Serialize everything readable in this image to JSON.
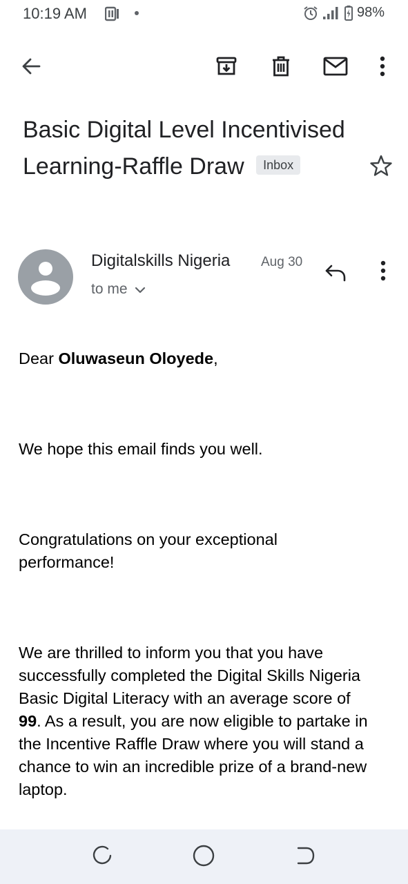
{
  "status": {
    "time": "10:19 AM",
    "battery": "98%",
    "icons": [
      "notification-icon",
      "alarm-icon",
      "signal-icon",
      "battery-icon"
    ]
  },
  "toolbar": {
    "icons": [
      "back-arrow-icon",
      "archive-icon",
      "delete-icon",
      "mark-unread-icon",
      "more-vert-icon"
    ]
  },
  "email": {
    "subject": "Basic Digital Level Incentivised Learning-Raffle Draw",
    "label": "Inbox",
    "sender": "Digitalskills  Nigeria",
    "date": "Aug 30",
    "recipient": "to me",
    "body": {
      "greeting_prefix": "Dear ",
      "recipient_name": "Oluwaseun Oloyede",
      "greeting_suffix": ",",
      "p1": "We hope this email finds you well.",
      "p2": "Congratulations on your exceptional performance!",
      "p3": "We are thrilled to inform you that you have successfully completed the Digital Skills Nigeria Basic Digital Literacy with an average score of",
      "score": "99",
      "p4": ".  As a result, you are now eligible to  partake in the Incentive Raffle Draw where you will stand a chance to win an incredible prize of a brand-new laptop."
    }
  },
  "colors": {
    "text": "#202124",
    "secondary": "#5f6368",
    "avatar_bg": "#9aa0a6",
    "chip_bg": "#e8eaed",
    "navbar_bg": "#eef1f7"
  }
}
